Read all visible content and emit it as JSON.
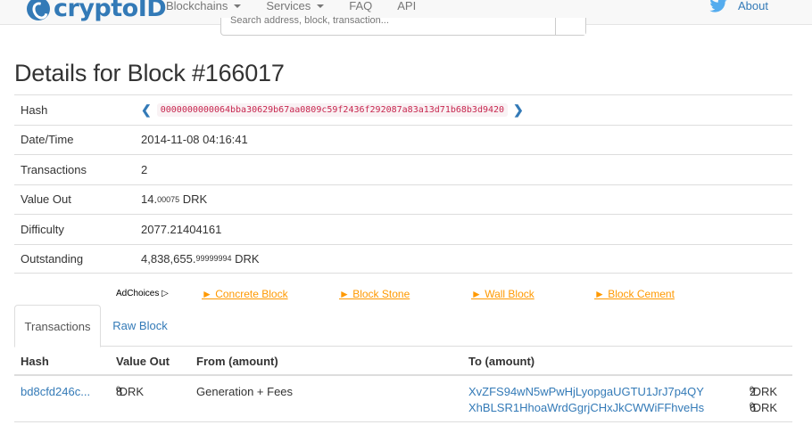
{
  "navbar": {
    "brand": "cryptoID",
    "items": [
      {
        "label": "Blockchains",
        "dropdown": true
      },
      {
        "label": "Services",
        "dropdown": true
      },
      {
        "label": "FAQ",
        "dropdown": false
      },
      {
        "label": "API",
        "dropdown": false
      }
    ],
    "about": "About"
  },
  "search": {
    "placeholder": "Search address, block, transaction..."
  },
  "page_title": "Details for Block #166017",
  "details": {
    "hash_label": "Hash",
    "hash_value": "0000000000064bba30629b67aa0809c59f2436f292087a83a13d71b68b3d9420",
    "datetime_label": "Date/Time",
    "datetime_value": "2014-11-08 04:16:41",
    "transactions_label": "Transactions",
    "transactions_value": "2",
    "value_out_label": "Value Out",
    "value_out_main": "14.",
    "value_out_small": "00075",
    "value_out_unit": " DRK",
    "difficulty_label": "Difficulty",
    "difficulty_value": "2077.21404161",
    "outstanding_label": "Outstanding",
    "outstanding_main": "4,838,655.",
    "outstanding_small": "99999994",
    "outstanding_unit": " DRK"
  },
  "ads": {
    "adchoices": "AdChoices",
    "links": [
      "► Concrete Block",
      "► Block Stone",
      "► Wall Block",
      "► Block Cement"
    ]
  },
  "tabs": {
    "transactions": "Transactions",
    "raw_block": "Raw Block"
  },
  "tx_table": {
    "headers": {
      "hash": "Hash",
      "value_out": "Value Out",
      "from": "From (amount)",
      "to": "To (amount)"
    },
    "rows": [
      {
        "hash": "bd8cfd246c...",
        "value_main": "8.",
        "value_small": "0",
        "value_unit": " DRK",
        "from": "Generation + Fees",
        "to": [
          {
            "address": "XvZFS94wN5wPwHjLyopgaUGTU1JrJ7p4QY",
            "amount_main": "2.",
            "amount_small": "0",
            "amount_unit": " DRK"
          },
          {
            "address": "XhBLSR1HhoaWrdGgrjCHxJkCWWiFFhveHs",
            "amount_main": "6.",
            "amount_small": "0",
            "amount_unit": " DRK"
          }
        ]
      }
    ]
  }
}
